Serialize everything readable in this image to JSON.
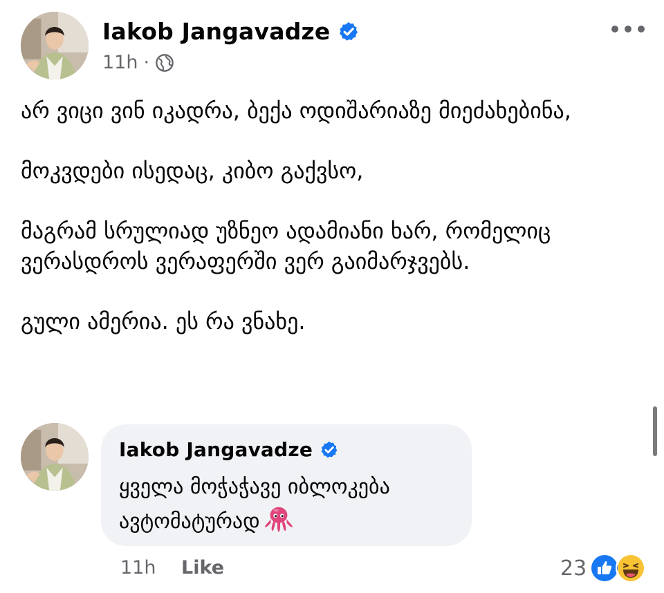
{
  "post": {
    "author": "Iakob Jangavadze",
    "time": "11h",
    "separator": "·",
    "body": [
      "არ ვიცი ვინ იკადრა, ბექა ოდიშარიაზე მიეძახებინა,",
      "მოკვდები ისედაც, კიბო გაქვსო,",
      "მაგრამ სრულიად უზნეო ადამიანი ხარ, რომელიც ვერასდროს ვერაფერში ვერ გაიმარჯვებს.",
      "გული ამერია. ეს რა ვნახე."
    ]
  },
  "comment": {
    "author": "Iakob Jangavadze",
    "text": "ყველა მოჭაჭავე იბლოკება ავტომატურად",
    "time": "11h",
    "like_label": "Like",
    "reaction_count": "23"
  },
  "icons": {
    "verified": "verified-badge-icon",
    "audience": "globe-icon",
    "more": "more-options-icon",
    "emoji": "octopus-emoji",
    "reactions": [
      "like-reaction-icon",
      "haha-reaction-icon"
    ]
  },
  "colors": {
    "verified_blue": "#1877f2",
    "secondary_text": "#65676b",
    "comment_bubble": "#f0f2f5",
    "octopus": "#e0457b",
    "haha_yellow": "#f7c234"
  }
}
